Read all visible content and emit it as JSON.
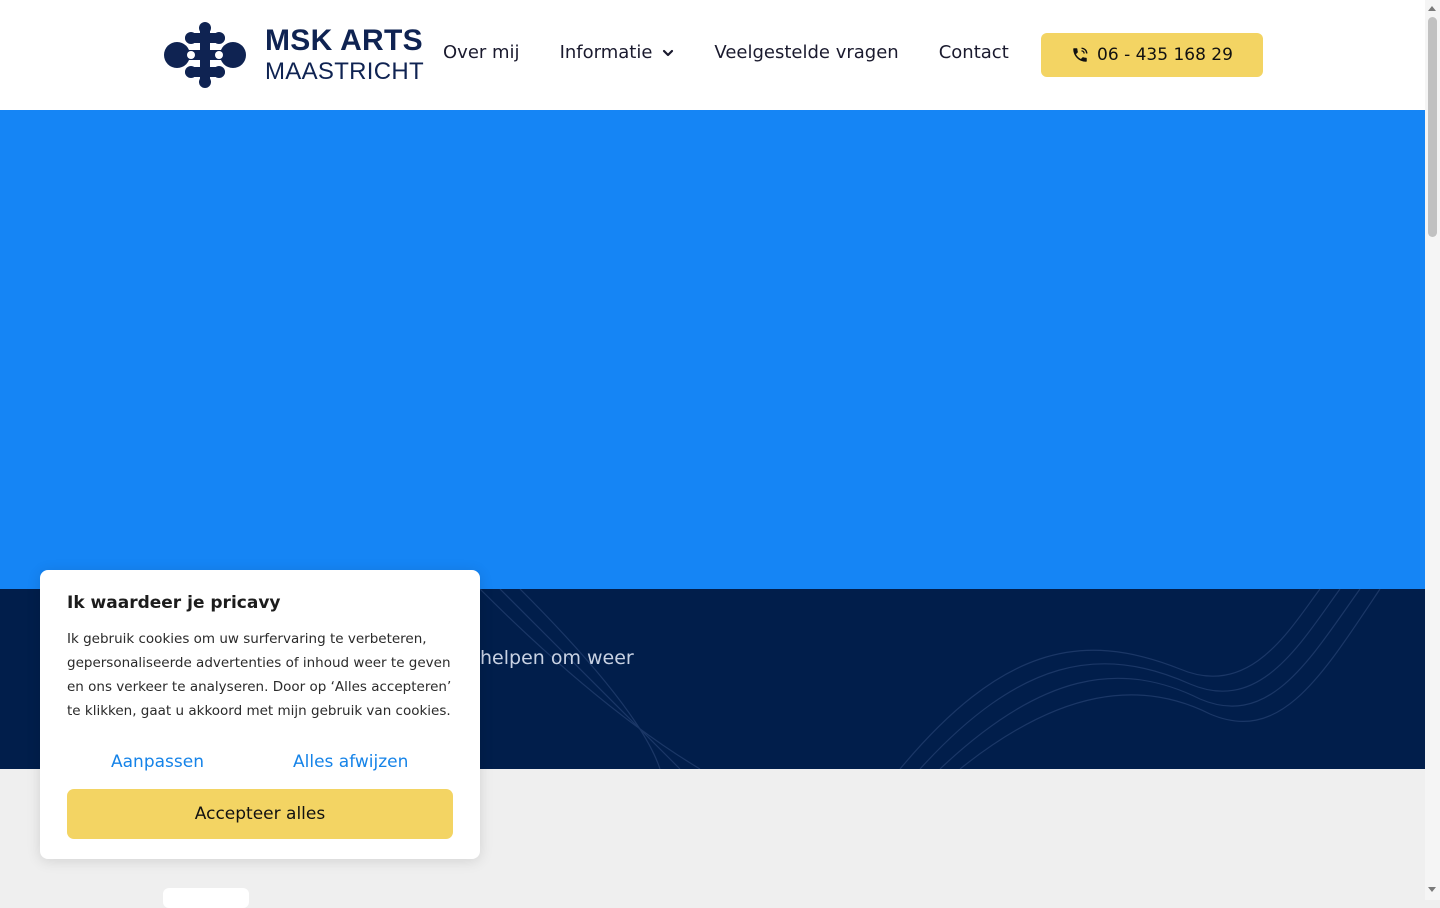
{
  "brand": {
    "name_line1": "MSK ARTS",
    "name_line2": "MAASTRICHT",
    "color": "#0f2352",
    "logo_icon": "molecule-logo-icon"
  },
  "nav": {
    "items": [
      {
        "label": "Over mij"
      },
      {
        "label": "Informatie",
        "has_dropdown": true
      },
      {
        "label": "Veelgestelde vragen"
      },
      {
        "label": "Contact"
      }
    ],
    "dropdown_icon": "chevron-down-icon"
  },
  "phone_button": {
    "label": "06 - 435 168 29",
    "icon": "phone-icon",
    "color": "#f3d463"
  },
  "hero": {
    "color": "#1585f5"
  },
  "intro_band": {
    "color": "#011e4b",
    "partial_text": "helpen om weer"
  },
  "cookie_banner": {
    "title": "Ik waardeer je pricavy",
    "body": "Ik gebruik cookies om uw surfervaring te verbeteren, gepersonaliseerde advertenties of inhoud weer te geven en ons verkeer te analyseren. Door op ‘Alles accepteren’ te klikken, gaat u akkoord met mijn gebruik van cookies.",
    "customize_label": "Aanpassen",
    "reject_label": "Alles afwijzen",
    "accept_label": "Accepteer alles",
    "link_color": "#1583e8",
    "accept_color": "#f3d463"
  }
}
